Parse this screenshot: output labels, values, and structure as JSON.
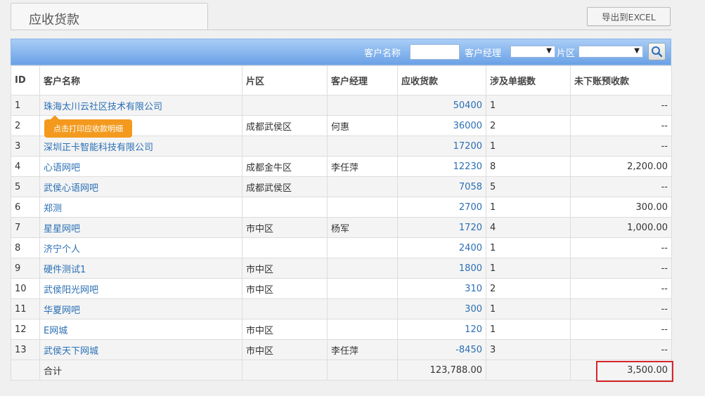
{
  "page": {
    "tab_title": "应收货款",
    "export_label": "导出到EXCEL"
  },
  "toolbar": {
    "customer_name_label": "客户名称",
    "customer_name_value": "",
    "manager_label": "客户经理",
    "manager_value": "",
    "area_label": "片区",
    "area_value": ""
  },
  "table": {
    "headers": [
      "ID",
      "客户名称",
      "片区",
      "客户经理",
      "应收货款",
      "涉及单据数",
      "未下账预收款"
    ],
    "rows": [
      [
        "1",
        "珠海太川云社区技术有限公司",
        "",
        "",
        "50400",
        "1",
        "--"
      ],
      [
        "2",
        "",
        "成都武侯区",
        "何惠",
        "36000",
        "2",
        "--"
      ],
      [
        "3",
        "深圳正卡智能科技有限公司",
        "",
        "",
        "17200",
        "1",
        "--"
      ],
      [
        "4",
        "心语网吧",
        "成都金牛区",
        "李任萍",
        "12230",
        "8",
        "2,200.00"
      ],
      [
        "5",
        "武侯心语网吧",
        "成都武侯区",
        "",
        "7058",
        "5",
        "--"
      ],
      [
        "6",
        "郑测",
        "",
        "",
        "2700",
        "1",
        "300.00"
      ],
      [
        "7",
        "星星网吧",
        "市中区",
        "杨军",
        "1720",
        "4",
        "1,000.00"
      ],
      [
        "8",
        "济宁个人",
        "",
        "",
        "2400",
        "1",
        "--"
      ],
      [
        "9",
        "硬件测试1",
        "市中区",
        "",
        "1800",
        "1",
        "--"
      ],
      [
        "10",
        "武侯阳光网吧",
        "市中区",
        "",
        "310",
        "2",
        "--"
      ],
      [
        "11",
        "华夏网吧",
        "",
        "",
        "300",
        "1",
        "--"
      ],
      [
        "12",
        "E网城",
        "市中区",
        "",
        "120",
        "1",
        "--"
      ],
      [
        "13",
        "武侯天下网城",
        "市中区",
        "李任萍",
        "-8450",
        "3",
        "--"
      ]
    ],
    "total": {
      "label": "合计",
      "receivable": "123,788.00",
      "prepaid": "3,500.00"
    }
  },
  "tooltip": {
    "text": "点击打印应收款明细"
  },
  "colors": {
    "accent_blue": "#6aa1e6",
    "link": "#2a6fb5",
    "tooltip": "#f39a1e",
    "highlight": "#d6262b"
  },
  "icons": {
    "search": "search-icon"
  }
}
